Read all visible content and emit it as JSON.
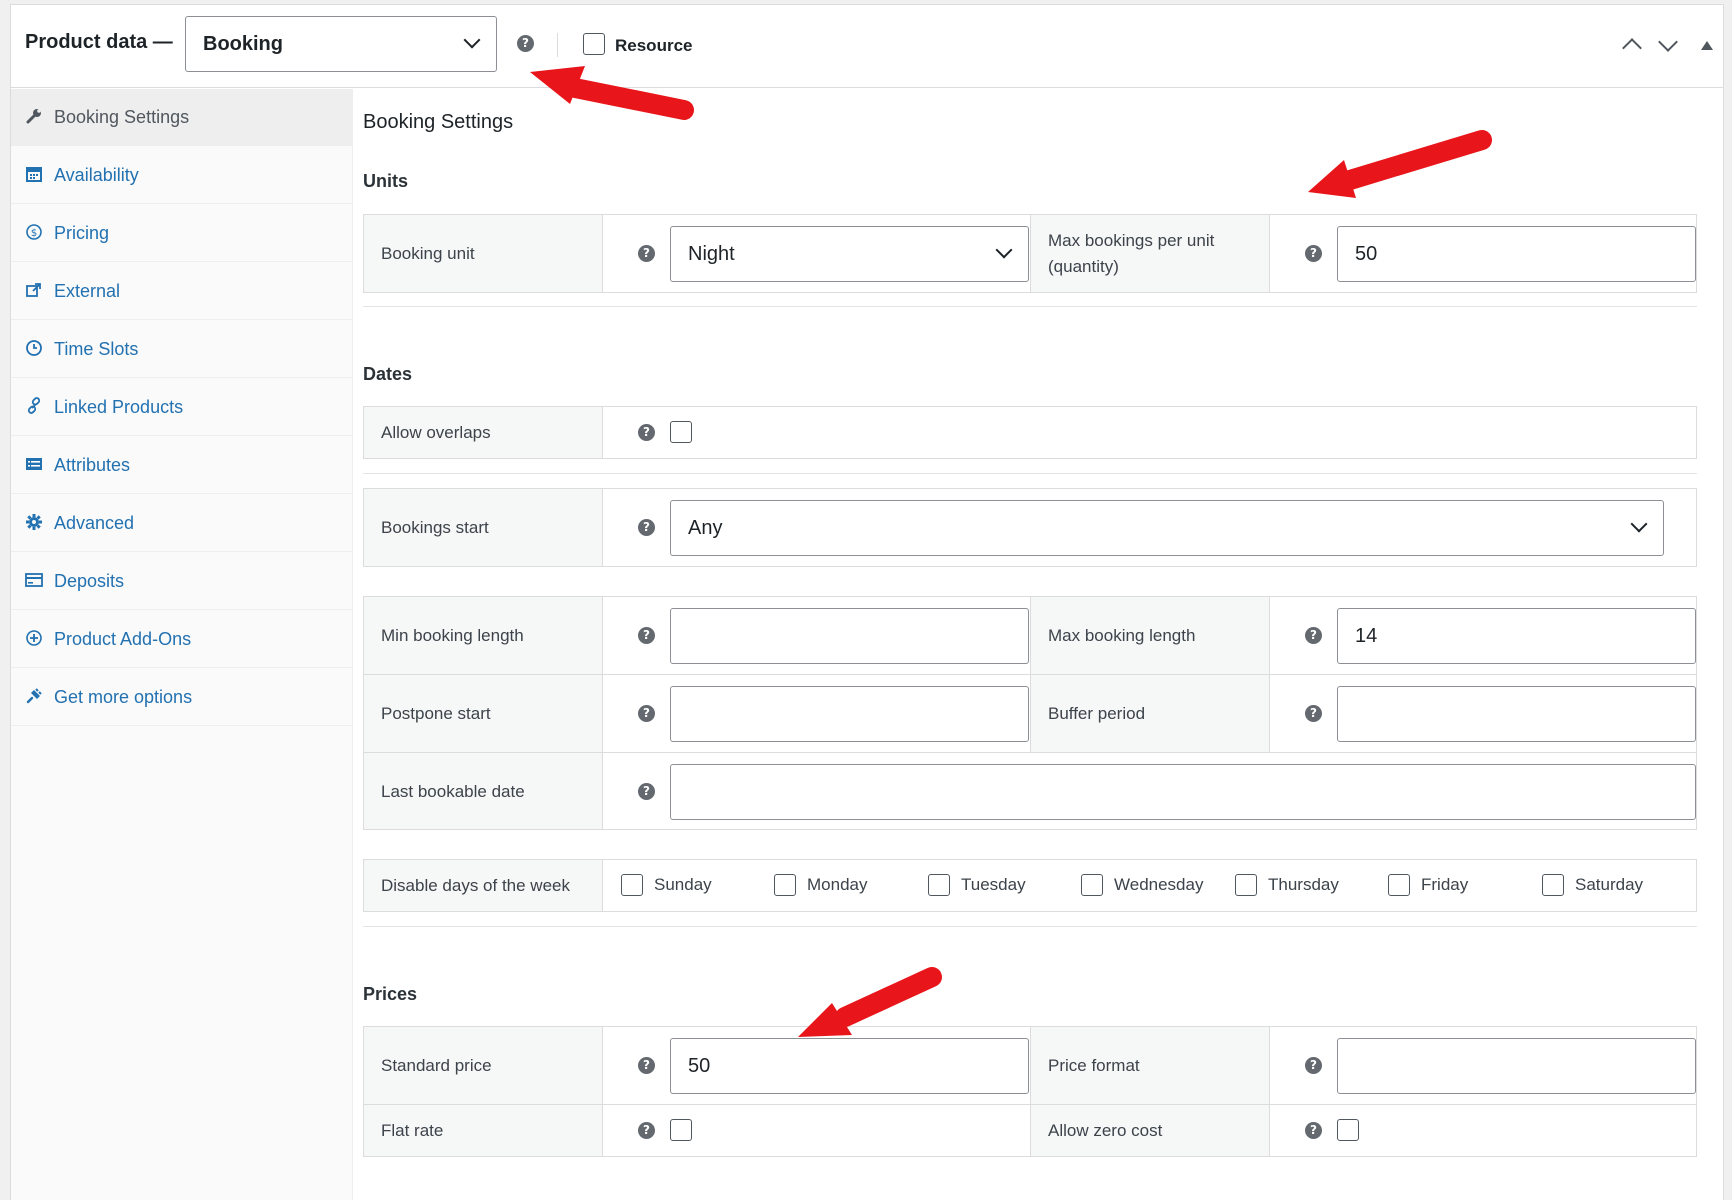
{
  "header": {
    "title": "Product data —",
    "product_type": "Booking",
    "resource_label": "Resource"
  },
  "sidebar": {
    "items": [
      {
        "label": "Booking Settings",
        "icon": "wrench-icon"
      },
      {
        "label": "Availability",
        "icon": "calendar-icon"
      },
      {
        "label": "Pricing",
        "icon": "dollar-icon"
      },
      {
        "label": "External",
        "icon": "external-link-icon"
      },
      {
        "label": "Time Slots",
        "icon": "clock-icon"
      },
      {
        "label": "Linked Products",
        "icon": "link-icon"
      },
      {
        "label": "Attributes",
        "icon": "list-icon"
      },
      {
        "label": "Advanced",
        "icon": "gear-icon"
      },
      {
        "label": "Deposits",
        "icon": "card-icon"
      },
      {
        "label": "Product Add-Ons",
        "icon": "plus-circle-icon"
      },
      {
        "label": "Get more options",
        "icon": "plugin-icon"
      }
    ]
  },
  "main": {
    "title": "Booking Settings",
    "units": {
      "title": "Units",
      "booking_unit_label": "Booking unit",
      "booking_unit_value": "Night",
      "max_bookings_label_1": "Max bookings per unit",
      "max_bookings_label_2": "(quantity)",
      "max_bookings_value": "50"
    },
    "dates": {
      "title": "Dates",
      "allow_overlaps_label": "Allow overlaps",
      "bookings_start_label": "Bookings start",
      "bookings_start_value": "Any",
      "min_length_label": "Min booking length",
      "min_length_value": "",
      "max_length_label": "Max booking length",
      "max_length_value": "14",
      "postpone_label": "Postpone start",
      "postpone_value": "",
      "buffer_label": "Buffer period",
      "buffer_value": "",
      "last_date_label": "Last bookable date",
      "last_date_value": "",
      "disable_days_label": "Disable days of the week",
      "days": [
        "Sunday",
        "Monday",
        "Tuesday",
        "Wednesday",
        "Thursday",
        "Friday",
        "Saturday"
      ]
    },
    "prices": {
      "title": "Prices",
      "standard_label": "Standard price",
      "standard_value": "50",
      "format_label": "Price format",
      "format_value": "",
      "flat_rate_label": "Flat rate",
      "zero_cost_label": "Allow zero cost"
    }
  },
  "colors": {
    "link": "#2271b1",
    "annotation_arrow": "#e8161b"
  }
}
